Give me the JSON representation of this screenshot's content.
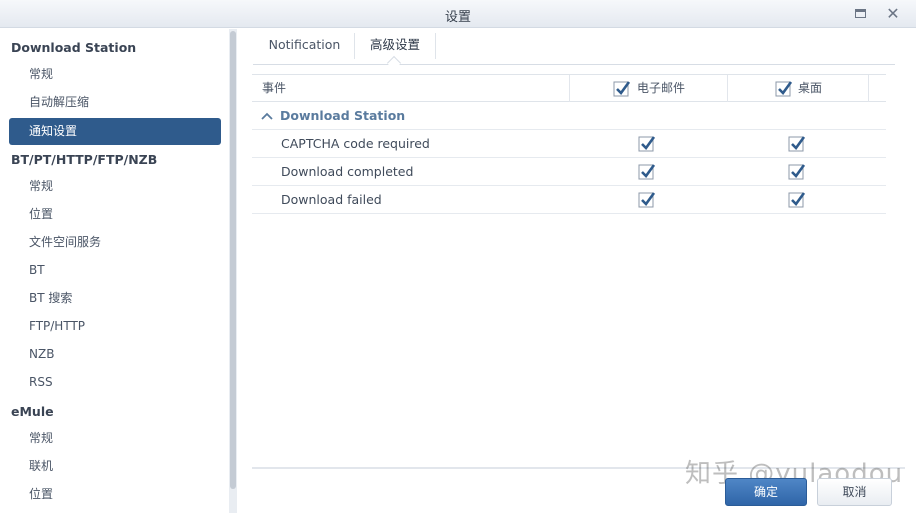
{
  "window": {
    "title": "设置"
  },
  "sidebar": {
    "groups": [
      {
        "label": "Download Station",
        "items": [
          "常规",
          "自动解压缩",
          "通知设置"
        ]
      },
      {
        "label": "BT/PT/HTTP/FTP/NZB",
        "items": [
          "常规",
          "位置",
          "文件空间服务",
          "BT",
          "BT 搜索",
          "FTP/HTTP",
          "NZB",
          "RSS"
        ]
      },
      {
        "label": "eMule",
        "items": [
          "常规",
          "联机",
          "位置"
        ]
      }
    ],
    "active_item": "通知设置"
  },
  "tabs": [
    {
      "label": "Notification"
    },
    {
      "label": "高级设置",
      "active": true
    }
  ],
  "table": {
    "columns": {
      "event": "事件",
      "email": "电子邮件",
      "desktop": "桌面"
    },
    "group": "Download Station",
    "rows": [
      {
        "label": "CAPTCHA code required",
        "email": true,
        "desktop": true
      },
      {
        "label": "Download completed",
        "email": true,
        "desktop": true
      },
      {
        "label": "Download failed",
        "email": true,
        "desktop": true
      }
    ]
  },
  "buttons": {
    "ok": "确定",
    "cancel": "取消"
  },
  "watermark": "知乎 @yulaodou",
  "colors": {
    "active_item": "#2f5b8c",
    "check": "#2f5b8c",
    "primary_button": "#3a72b8",
    "group_label": "#5a7b9e"
  }
}
